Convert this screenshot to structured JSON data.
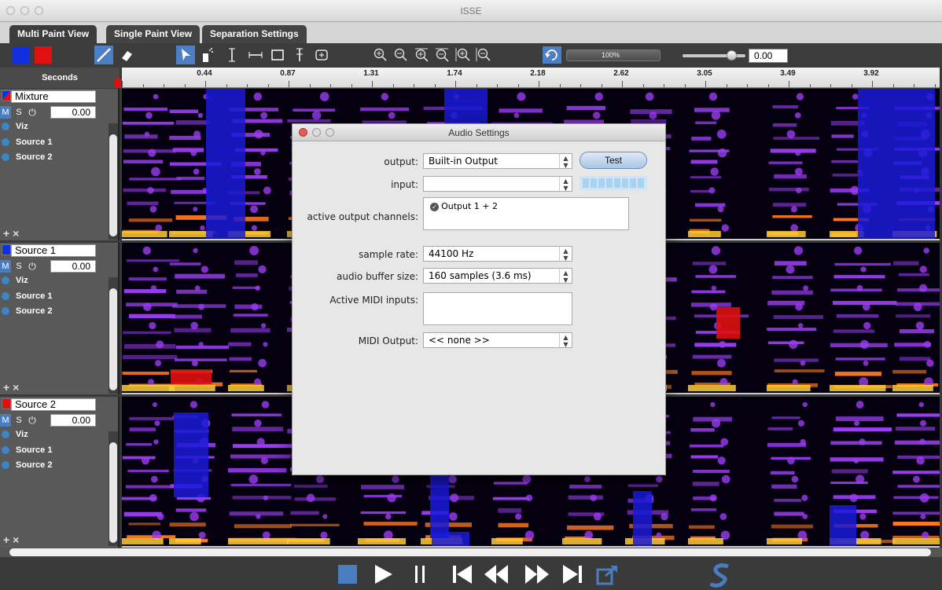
{
  "window": {
    "title": "ISSE"
  },
  "tabs": [
    {
      "label": "Multi Paint View",
      "active": true
    },
    {
      "label": "Single Paint View",
      "active": false
    },
    {
      "label": "Separation Settings",
      "active": false
    }
  ],
  "toolbar": {
    "zoom_percent": "100%",
    "value": "0.00",
    "brush_colors": [
      "#1030e0",
      "#e01010"
    ]
  },
  "ruler": {
    "label": "Seconds",
    "ticks": [
      "0.44",
      "0.87",
      "1.31",
      "1.74",
      "2.18",
      "2.62",
      "3.05",
      "3.49",
      "3.92"
    ]
  },
  "tracks": [
    {
      "name": "Mixture",
      "mute": "M",
      "solo": "S",
      "gain": "0.00",
      "layers": [
        "Viz",
        "Source 1",
        "Source 2"
      ],
      "color": "mixed"
    },
    {
      "name": "Source 1",
      "mute": "M",
      "solo": "S",
      "gain": "0.00",
      "layers": [
        "Viz",
        "Source 1",
        "Source 2"
      ],
      "color": "#1030e0"
    },
    {
      "name": "Source 2",
      "mute": "M",
      "solo": "S",
      "gain": "0.00",
      "layers": [
        "Viz",
        "Source 1",
        "Source 2"
      ],
      "color": "#e01010"
    }
  ],
  "track_controls": {
    "add": "+",
    "remove": "×"
  },
  "dialog": {
    "title": "Audio Settings",
    "output_label": "output:",
    "output_value": "Built-in Output",
    "test_label": "Test",
    "input_label": "input:",
    "input_value": "",
    "channels_label": "active output channels:",
    "channel_item": "Output 1 + 2",
    "sample_rate_label": "sample rate:",
    "sample_rate_value": "44100 Hz",
    "buffer_label": "audio buffer size:",
    "buffer_value": "160 samples (3.6 ms)",
    "midi_in_label": "Active MIDI inputs:",
    "midi_out_label": "MIDI Output:",
    "midi_out_value": "<< none >>"
  },
  "colors": {
    "accent": "#4a7cc0",
    "spectrogram_bg": "#050010",
    "spectrogram_purple": "#9b3cf0",
    "spectrogram_orange": "#ff7a20",
    "selection_blue": "#1a1ad8",
    "selection_red": "#e01010"
  }
}
